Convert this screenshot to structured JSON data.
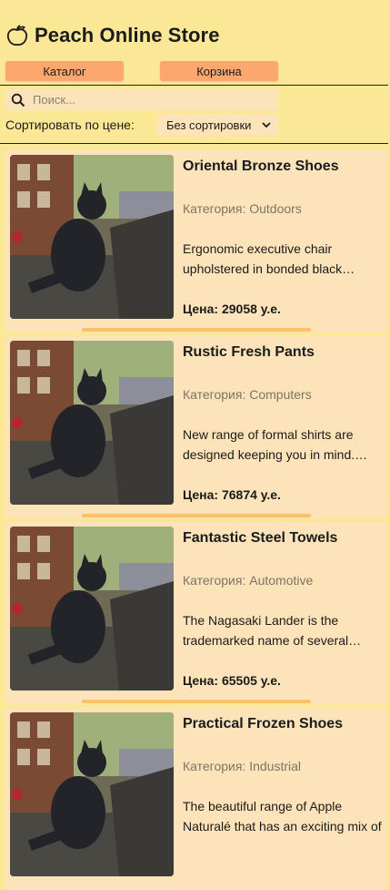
{
  "header": {
    "title": "Peach Online Store",
    "logo_icon": "peach-icon"
  },
  "nav": {
    "catalog_label": "Каталог",
    "cart_label": "Корзина"
  },
  "search": {
    "placeholder": "Поиск...",
    "value": "",
    "icon": "search-icon"
  },
  "sort": {
    "label": "Сортировать по цене:",
    "selected": "Без сортировки"
  },
  "products": [
    {
      "title": "Oriental Bronze Shoes",
      "category": "Категория: Outdoors",
      "description": "Ergonomic executive chair upholstered in bonded black leather and PVC",
      "price": "Цена: 29058 у.е."
    },
    {
      "title": "Rustic Fresh Pants",
      "category": "Категория: Computers",
      "description": "New range of formal shirts are designed keeping you in mind. With fits",
      "price": "Цена: 76874 у.е."
    },
    {
      "title": "Fantastic Steel Towels",
      "category": "Категория: Automotive",
      "description": "The Nagasaki Lander is the trademarked name of several series",
      "price": "Цена: 65505 у.е."
    },
    {
      "title": "Practical Frozen Shoes",
      "category": "Категория: Industrial",
      "description": "The beautiful range of Apple Naturalé that has an exciting mix of",
      "price": ""
    }
  ],
  "colors": {
    "background": "#fbe896",
    "button": "#fda66e",
    "card": "#fde3b9",
    "accent_bar": "#fcbf6a"
  }
}
